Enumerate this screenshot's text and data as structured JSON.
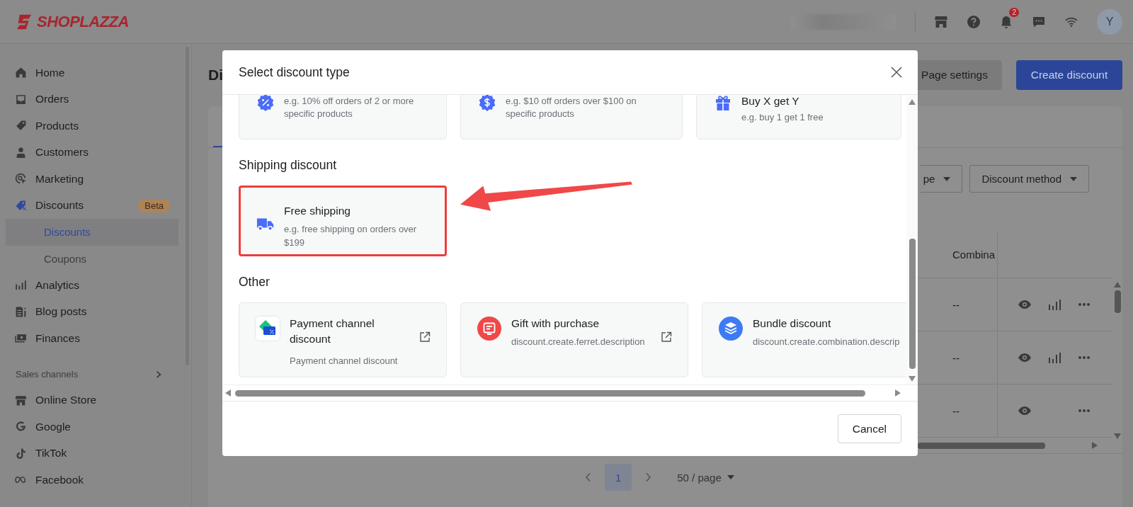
{
  "header": {
    "logo": "SHOPLAZZA",
    "notification_count": "2",
    "avatar_initial": "Y"
  },
  "sidebar": {
    "items": [
      {
        "label": "Home",
        "selected": false
      },
      {
        "label": "Orders",
        "selected": false
      },
      {
        "label": "Products",
        "selected": false
      },
      {
        "label": "Customers",
        "selected": false
      },
      {
        "label": "Marketing",
        "selected": false
      },
      {
        "label": "Discounts",
        "selected": true,
        "badge": "Beta",
        "children": [
          {
            "label": "Discounts",
            "selected": true
          },
          {
            "label": "Coupons",
            "selected": false
          }
        ]
      },
      {
        "label": "Analytics",
        "selected": false
      },
      {
        "label": "Blog posts",
        "selected": false
      },
      {
        "label": "Finances",
        "selected": false
      }
    ],
    "sales_channels": {
      "title": "Sales channels",
      "items": [
        {
          "label": "Online Store",
          "selected": false
        },
        {
          "label": "Google",
          "selected": false
        },
        {
          "label": "TikTok",
          "selected": false
        },
        {
          "label": "Facebook",
          "selected": false
        }
      ]
    }
  },
  "page": {
    "title": "Di",
    "buttons": [
      {
        "label": "Page settings",
        "kind": "secondary"
      },
      {
        "label": "Create discount",
        "kind": "primary"
      }
    ],
    "filters": [
      "pe",
      "Discount method"
    ],
    "table": {
      "columns": [
        "Combina"
      ],
      "rows": [
        {
          "column_1": "--",
          "stats": true
        },
        {
          "column_1": "--",
          "stats": true
        },
        {
          "column_1": "--",
          "stats": false
        }
      ]
    },
    "pagination": {
      "pages": [
        {
          "label": "1",
          "selected": true
        }
      ],
      "page_size": "50 / page"
    }
  },
  "modal": {
    "title": "Select discount type",
    "sections": [
      {
        "cards": [
          {
            "kind": "percent",
            "description": "e.g. 10% off orders of 2 or more specific products"
          },
          {
            "kind": "dollar",
            "description": "e.g. $10 off orders over $100 on specific products"
          },
          {
            "kind": "gift",
            "title": "Buy X get Y",
            "description": "e.g. buy 1 get 1 free"
          }
        ]
      },
      {
        "title": "Shipping discount",
        "cards": [
          {
            "kind": "truck",
            "title": "Free shipping",
            "description": "e.g. free shipping on orders over $199",
            "highlighted": true
          }
        ]
      },
      {
        "title": "Other",
        "cards": [
          {
            "kind": "payment",
            "title": "Payment channel discount",
            "description": "Payment channel discount",
            "external_link": true
          },
          {
            "kind": "present",
            "title": "Gift with purchase",
            "description": "discount.create.ferret.description",
            "external_link": true
          },
          {
            "kind": "bundle",
            "title": "Bundle discount",
            "description": "discount.create.combination.descrip",
            "external_link": false
          }
        ]
      }
    ],
    "cancel": "Cancel"
  }
}
